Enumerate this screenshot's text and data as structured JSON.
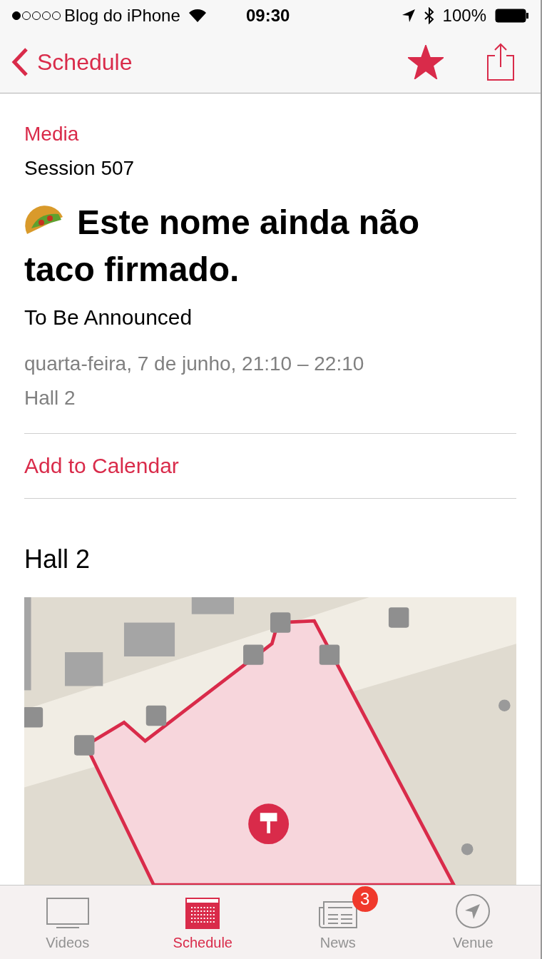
{
  "status_bar": {
    "carrier": "Blog do iPhone",
    "time": "09:30",
    "battery": "100%"
  },
  "nav": {
    "back": "Schedule",
    "favorite": true
  },
  "session": {
    "track": "Media",
    "number": "Session 507",
    "title": "Este nome ainda não taco firmado.",
    "speaker": "To Be Announced",
    "when": "quarta-feira, 7 de junho, 21:10 – 22:10",
    "room": "Hall 2"
  },
  "add_to_calendar": "Add to Calendar",
  "location": {
    "heading": "Hall 2"
  },
  "tabs": [
    {
      "kind": "videos",
      "label": "Videos",
      "selected": false
    },
    {
      "kind": "schedule",
      "label": "Schedule",
      "selected": true
    },
    {
      "kind": "news",
      "label": "News",
      "selected": false,
      "badge": "3"
    },
    {
      "kind": "venue",
      "label": "Venue",
      "selected": false
    }
  ]
}
